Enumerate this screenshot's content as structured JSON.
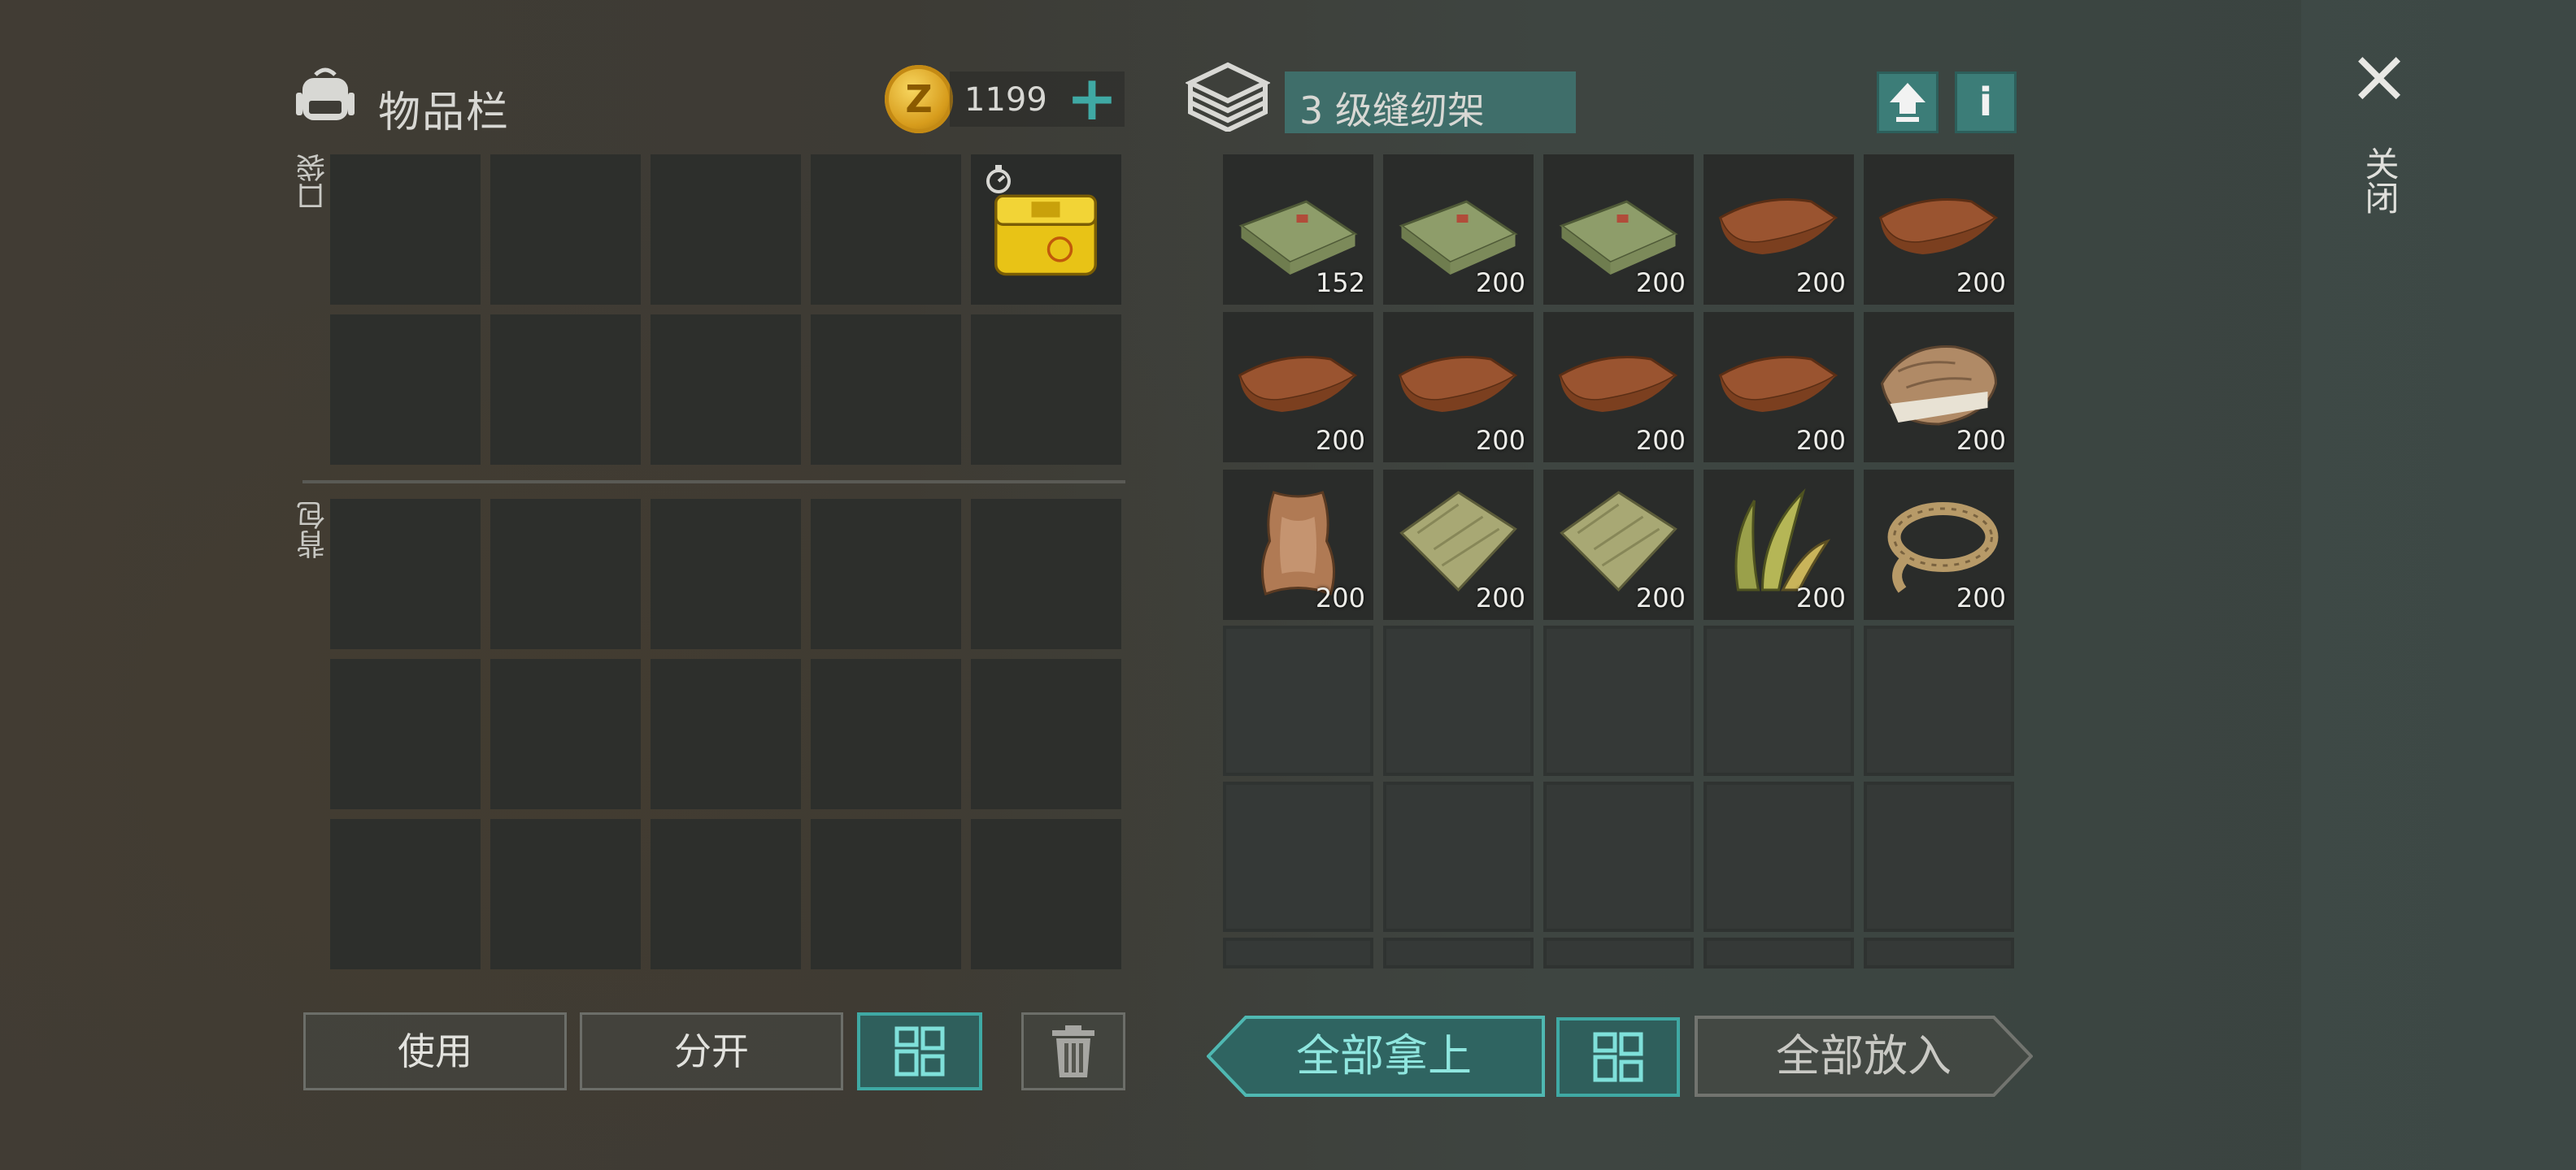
{
  "inventory": {
    "title": "物品栏",
    "coins": "1199",
    "pocket_label": "口袋",
    "backpack_label": "背包",
    "pocket_item_qty": ""
  },
  "storage": {
    "title": "3 级缝纫架",
    "upload_icon": "arrow-up-icon",
    "info_label": "i",
    "items": [
      {
        "icon": "cloth-icon",
        "qty": "152"
      },
      {
        "icon": "cloth-icon",
        "qty": "200"
      },
      {
        "icon": "cloth-icon",
        "qty": "200"
      },
      {
        "icon": "leather-icon",
        "qty": "200"
      },
      {
        "icon": "leather-icon",
        "qty": "200"
      },
      {
        "icon": "leather-icon",
        "qty": "200"
      },
      {
        "icon": "leather-icon",
        "qty": "200"
      },
      {
        "icon": "leather-icon",
        "qty": "200"
      },
      {
        "icon": "leather-icon",
        "qty": "200"
      },
      {
        "icon": "fur-icon",
        "qty": "200"
      },
      {
        "icon": "hide-icon",
        "qty": "200"
      },
      {
        "icon": "burlap-icon",
        "qty": "200"
      },
      {
        "icon": "burlap-icon",
        "qty": "200"
      },
      {
        "icon": "plant-fiber-icon",
        "qty": "200"
      },
      {
        "icon": "rope-icon",
        "qty": "200"
      }
    ]
  },
  "close_label": "关闭",
  "buttons": {
    "use": "使用",
    "split": "分开",
    "take_all": "全部拿上",
    "put_all": "全部放入"
  },
  "colors": {
    "accent": "#3fa9a4",
    "slot": "#2d2f2c"
  }
}
